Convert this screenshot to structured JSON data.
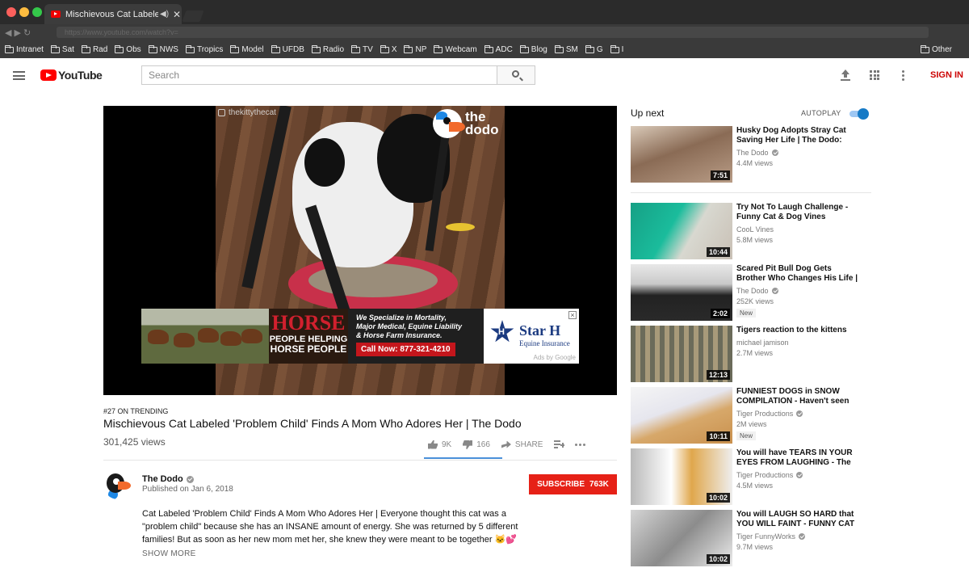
{
  "browser": {
    "tab_title": "Mischievous Cat Labeled 'P",
    "address_text": "https://www.youtube.com/watch?v=",
    "bookmarks": [
      "Intranet",
      "Sat",
      "Rad",
      "Obs",
      "NWS",
      "Tropics",
      "Model",
      "UFDB",
      "Radio",
      "TV",
      "X",
      "NP",
      "Webcam",
      "ADC",
      "Blog",
      "SM",
      "G",
      "I"
    ],
    "bookmark_other": "Other"
  },
  "header": {
    "logo_text": "YouTube",
    "search_placeholder": "Search",
    "signin_label": "SIGN IN"
  },
  "player": {
    "watermark": "thekittythecat",
    "brand_line1": "the",
    "brand_line2": "dodo",
    "ad": {
      "headline": "HORSE",
      "sub1": "PEOPLE HELPING",
      "sub2": "HORSE PEOPLE",
      "tagline_1": "We Specialize in Mortality,",
      "tagline_2": "Major Medical, Equine Liability",
      "tagline_3": "& Horse Farm Insurance.",
      "call": "Call Now: 877-321-4210",
      "brand": "Star H",
      "brand_sub": "Equine Insurance",
      "ads_by": "Ads by Google",
      "close": "×"
    }
  },
  "video": {
    "trending": "#27 ON TRENDING",
    "title": "Mischievous Cat Labeled 'Problem Child' Finds A Mom Who Adores Her | The Dodo",
    "views": "301,425 views",
    "likes": "9K",
    "dislikes": "166",
    "like_ratio": 0.98,
    "share_label": "SHARE"
  },
  "channel": {
    "name": "The Dodo",
    "published": "Published on Jan 6, 2018",
    "subscribe_label": "SUBSCRIBE",
    "subscriber_count": "763K",
    "description_1": "Cat Labeled 'Problem Child' Finds A Mom Who Adores Her | Everyone thought this cat was a",
    "description_2": "\"problem child\" because she has an INSANE amount of energy.  She was returned by 5 different",
    "description_3": "families! But as soon as her new mom met her, she knew they were meant to be together 🐱💕",
    "show_more": "SHOW MORE"
  },
  "sidebar": {
    "up_next": "Up next",
    "autoplay_label": "AUTOPLAY",
    "autoplay_on": true,
    "items": [
      {
        "title1": "Husky Dog Adopts Stray Cat",
        "title2": "Saving Her Life | The Dodo:",
        "channel": "The Dodo",
        "views": "4.4M views",
        "duration": "7:51",
        "verified": true
      },
      {
        "title1": "Try Not To Laugh Challenge -",
        "title2": "Funny Cat & Dog Vines",
        "channel": "CooL Vines",
        "views": "5.8M views",
        "duration": "10:44",
        "verified": false
      },
      {
        "title1": "Scared Pit Bull Dog Gets",
        "title2": "Brother Who Changes His Life |",
        "channel": "The Dodo",
        "views": "252K views",
        "duration": "2:02",
        "verified": true,
        "badge": "New"
      },
      {
        "title1": "Tigers reaction to the kittens",
        "title2": "",
        "channel": "michael jamison",
        "views": "2.7M views",
        "duration": "12:13",
        "verified": false
      },
      {
        "title1": "FUNNIEST DOGS in SNOW",
        "title2": "COMPILATION - Haven't seen",
        "channel": "Tiger Productions",
        "views": "2M views",
        "duration": "10:11",
        "verified": true,
        "badge": "New"
      },
      {
        "title1": "You will have TEARS IN YOUR",
        "title2": "EYES FROM LAUGHING - The",
        "channel": "Tiger Productions",
        "views": "4.5M views",
        "duration": "10:02",
        "verified": true
      },
      {
        "title1": "You will LAUGH SO HARD that",
        "title2": "YOU WILL FAINT - FUNNY CAT",
        "channel": "Tiger FunnyWorks",
        "views": "9.7M views",
        "duration": "10:02",
        "verified": true
      }
    ]
  },
  "colors": {
    "brand_red": "#ff0000",
    "subscribe_red": "#e62117",
    "autoplay_blue": "#167ac6",
    "chrome_dark": "#3a3a3a"
  }
}
